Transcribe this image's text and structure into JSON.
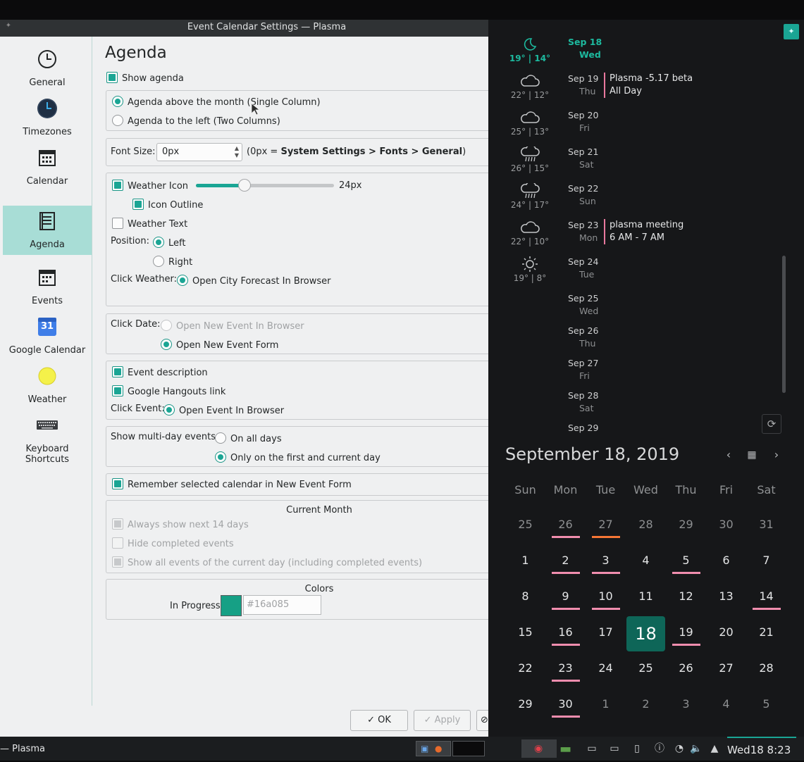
{
  "window": {
    "title": "Event Calendar Settings — Plasma"
  },
  "sidebar": {
    "items": [
      {
        "label": "General",
        "icon": "clock-icon"
      },
      {
        "label": "Timezones",
        "icon": "globe-clock-icon"
      },
      {
        "label": "Calendar",
        "icon": "calendar-icon"
      },
      {
        "label": "Agenda",
        "icon": "agenda-list-icon"
      },
      {
        "label": "Events",
        "icon": "events-calendar-icon"
      },
      {
        "label": "Google Calendar",
        "icon": "google-calendar-icon",
        "badge": "31"
      },
      {
        "label": "Weather",
        "icon": "sun-icon"
      },
      {
        "label": "Keyboard Shortcuts",
        "icon": "keyboard-icon"
      }
    ],
    "active": "Agenda"
  },
  "page": {
    "heading": "Agenda",
    "show_agenda": "Show agenda",
    "layout_single": "Agenda above the month (Single Column)",
    "layout_two": "Agenda to the left (Two Columns)",
    "font_size_label": "Font Size:",
    "font_size_value": "0px",
    "font_hint_prefix": "(0px = ",
    "font_hint_bold": "System Settings > Fonts > General",
    "font_hint_suffix": ")",
    "weather_icon": "Weather Icon",
    "weather_icon_size": "24px",
    "weather_icon_level": 0.35,
    "icon_outline": "Icon Outline",
    "weather_text": "Weather Text",
    "position_label": "Position:",
    "position_left": "Left",
    "position_right": "Right",
    "click_weather_label": "Click Weather:",
    "click_weather_option": "Open City Forecast In Browser",
    "click_date_label": "Click Date:",
    "click_date_browser": "Open New Event In Browser",
    "click_date_form": "Open New Event Form",
    "event_description": "Event description",
    "hangouts_link": "Google Hangouts link",
    "click_event_label": "Click Event:",
    "click_event_option": "Open Event In Browser",
    "multiday_label": "Show multi-day events:",
    "multiday_all": "On all days",
    "multiday_first": "Only on the first and current day",
    "remember_calendar": "Remember selected calendar in New Event Form",
    "current_month_title": "Current Month",
    "always_14": "Always show next 14 days",
    "hide_completed": "Hide completed events",
    "show_all_today": "Show all events of the current day (including completed events)",
    "colors_title": "Colors",
    "in_progress_label": "In Progress",
    "in_progress_color": "#16a085",
    "in_progress_placeholder": "#16a085"
  },
  "buttons": {
    "ok": "✓ OK",
    "apply": "✓ Apply"
  },
  "weather": [
    {
      "icon": "moon-icon",
      "temps": "19° | 14°"
    },
    {
      "icon": "cloud-icon",
      "temps": "22° | 12°"
    },
    {
      "icon": "cloud-icon",
      "temps": "25° | 13°"
    },
    {
      "icon": "rain-icon",
      "temps": "26° | 15°"
    },
    {
      "icon": "rain-icon",
      "temps": "24° | 17°"
    },
    {
      "icon": "cloud-icon",
      "temps": "22° | 10°"
    },
    {
      "icon": "sun-icon",
      "temps": "19° | 8°"
    }
  ],
  "agenda": [
    {
      "date": "Sep 18",
      "dow": "Wed",
      "today": true
    },
    {
      "date": "Sep 19",
      "dow": "Thu",
      "event": "Plasma -5.17 beta",
      "time": "All Day"
    },
    {
      "date": "Sep 20",
      "dow": "Fri"
    },
    {
      "date": "Sep 21",
      "dow": "Sat"
    },
    {
      "date": "Sep 22",
      "dow": "Sun"
    },
    {
      "date": "Sep 23",
      "dow": "Mon",
      "event": "plasma meeting",
      "time": "6 AM - 7 AM"
    },
    {
      "date": "Sep 24",
      "dow": "Tue"
    },
    {
      "date": "Sep 25",
      "dow": "Wed"
    },
    {
      "date": "Sep 26",
      "dow": "Thu"
    },
    {
      "date": "Sep 27",
      "dow": "Fri"
    },
    {
      "date": "Sep 28",
      "dow": "Sat"
    },
    {
      "date": "Sep 29",
      "dow": ""
    }
  ],
  "calendar": {
    "title": "September 18, 2019",
    "day_headers": [
      "Sun",
      "Mon",
      "Tue",
      "Wed",
      "Thu",
      "Fri",
      "Sat"
    ],
    "weeks": [
      [
        [
          "25",
          "other",
          ""
        ],
        [
          "26",
          "other",
          "pink"
        ],
        [
          "27",
          "other",
          "orange"
        ],
        [
          "28",
          "other",
          ""
        ],
        [
          "29",
          "other",
          ""
        ],
        [
          "30",
          "other",
          ""
        ],
        [
          "31",
          "other",
          ""
        ]
      ],
      [
        [
          "1",
          "",
          ""
        ],
        [
          "2",
          "",
          "pink"
        ],
        [
          "3",
          "",
          "pink"
        ],
        [
          "4",
          "",
          ""
        ],
        [
          "5",
          "",
          "pink"
        ],
        [
          "6",
          "",
          ""
        ],
        [
          "7",
          "",
          ""
        ]
      ],
      [
        [
          "8",
          "",
          ""
        ],
        [
          "9",
          "",
          "pink"
        ],
        [
          "10",
          "",
          "pink"
        ],
        [
          "11",
          "",
          ""
        ],
        [
          "12",
          "",
          ""
        ],
        [
          "13",
          "",
          ""
        ],
        [
          "14",
          "",
          "pink"
        ]
      ],
      [
        [
          "15",
          "",
          ""
        ],
        [
          "16",
          "",
          "pink"
        ],
        [
          "17",
          "",
          ""
        ],
        [
          "18",
          "today",
          ""
        ],
        [
          "19",
          "",
          "pink"
        ],
        [
          "20",
          "",
          ""
        ],
        [
          "21",
          "",
          ""
        ]
      ],
      [
        [
          "22",
          "",
          ""
        ],
        [
          "23",
          "",
          "pink"
        ],
        [
          "24",
          "",
          ""
        ],
        [
          "25",
          "",
          ""
        ],
        [
          "26",
          "",
          ""
        ],
        [
          "27",
          "",
          ""
        ],
        [
          "28",
          "",
          ""
        ]
      ],
      [
        [
          "29",
          "",
          ""
        ],
        [
          "30",
          "",
          "pink"
        ],
        [
          "1",
          "other",
          ""
        ],
        [
          "2",
          "other",
          ""
        ],
        [
          "3",
          "other",
          ""
        ],
        [
          "4",
          "other",
          ""
        ],
        [
          "5",
          "other",
          ""
        ]
      ]
    ]
  },
  "taskbar": {
    "task_label": "— Plasma",
    "clock": "Wed18 8:23"
  },
  "colors": {
    "accent": "#1aa594",
    "event_bar": "#f08dae",
    "today_bg": "#0e6658"
  }
}
